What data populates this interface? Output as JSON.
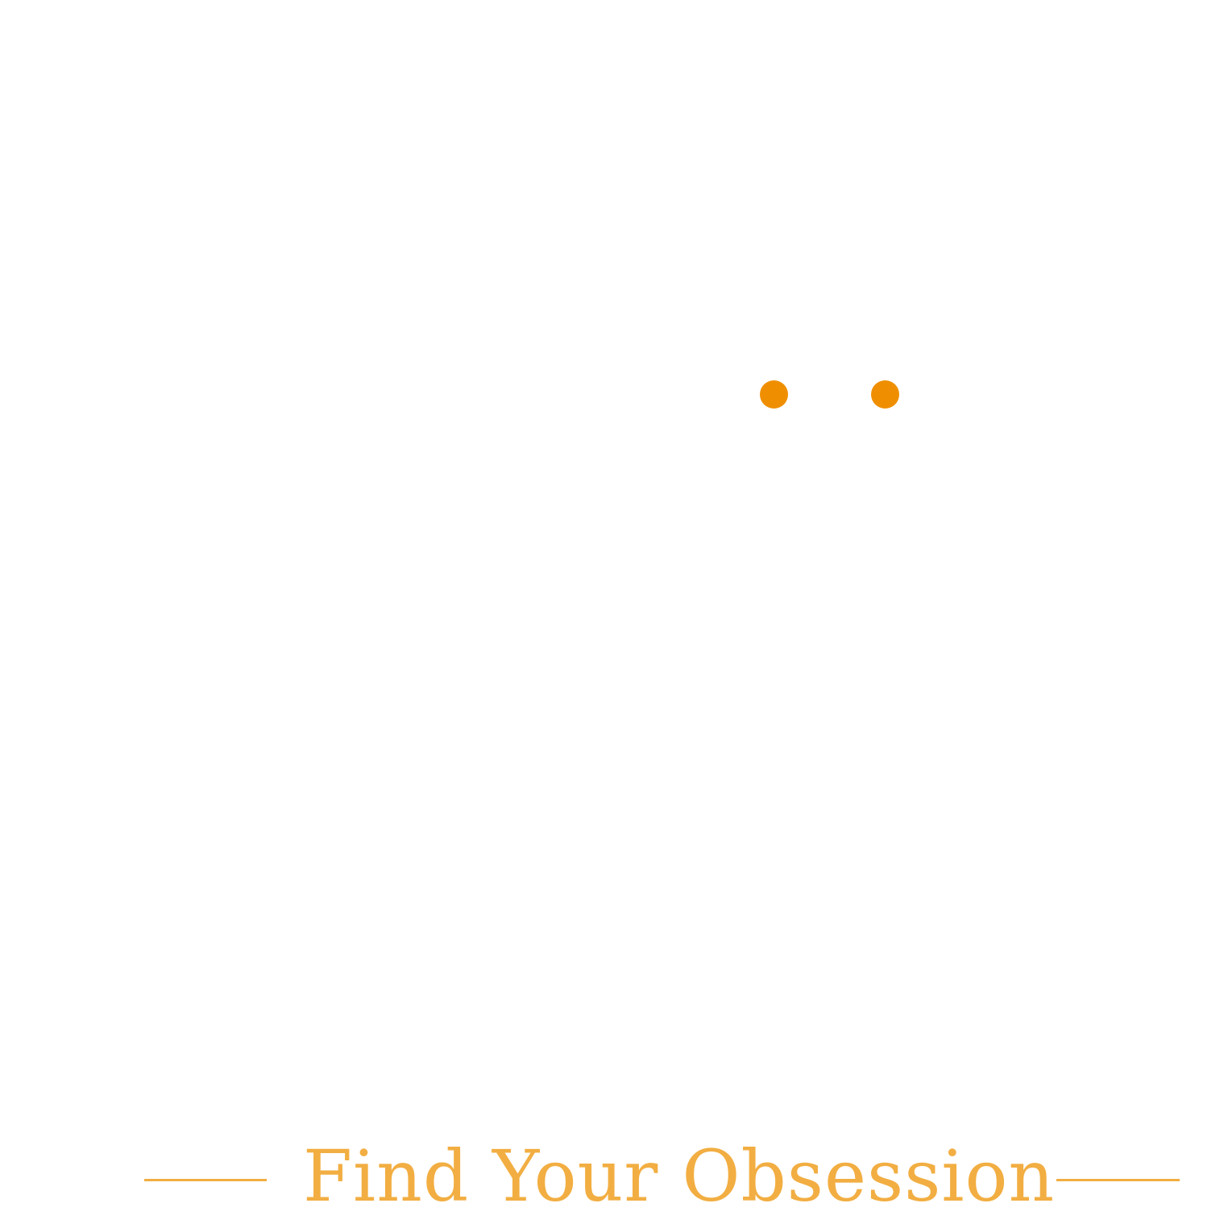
{
  "brand": {
    "accent_color": "#EF8F00",
    "tagline_color": "#F2AE42"
  },
  "tagline": {
    "text": "Find Your Obsession"
  }
}
